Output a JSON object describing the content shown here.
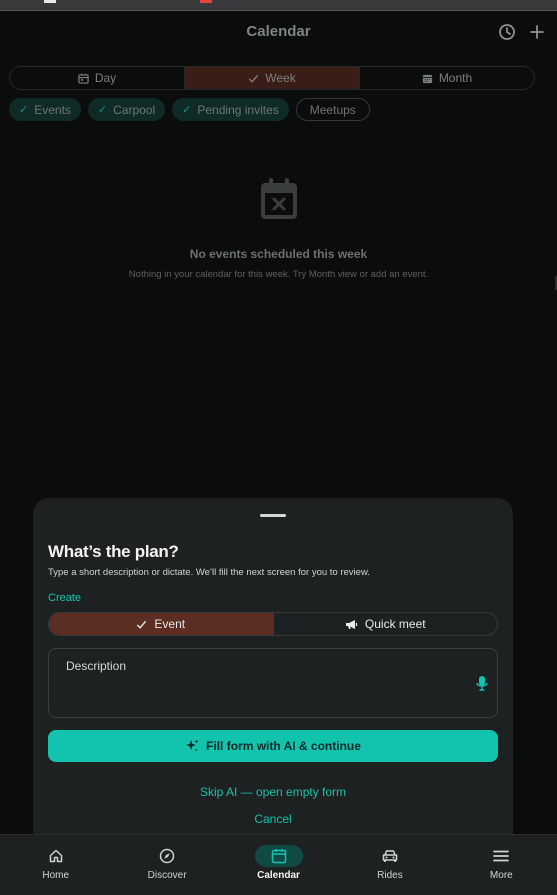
{
  "header": {
    "title": "Calendar",
    "history_icon": "history-icon",
    "add_icon": "plus-icon"
  },
  "views": [
    {
      "label": "Day",
      "icon": "calendar-day-icon",
      "active": false
    },
    {
      "label": "Week",
      "icon": "check-icon",
      "active": true
    },
    {
      "label": "Month",
      "icon": "calendar-month-icon",
      "active": false
    }
  ],
  "filters": [
    {
      "label": "Events",
      "on": true
    },
    {
      "label": "Carpool",
      "on": true
    },
    {
      "label": "Pending invites",
      "on": true
    },
    {
      "label": "Meetups",
      "on": false
    }
  ],
  "empty": {
    "icon": "calendar-x-icon",
    "title": "No events scheduled this week",
    "subtitle": "Nothing in your calendar for this week. Try Month view or add an event."
  },
  "sheet": {
    "title": "What’s the plan?",
    "subtitle": "Type a short description or dictate. We’ll fill the next screen for you to review.",
    "create_label": "Create",
    "kinds": [
      {
        "label": "Event",
        "icon": "check-icon",
        "active": true
      },
      {
        "label": "Quick meet",
        "icon": "megaphone-icon",
        "active": false
      }
    ],
    "description_label": "Description",
    "mic_icon": "microphone-icon",
    "primary_button": "Fill form with AI & continue",
    "skip_link": "Skip AI — open empty form",
    "cancel_link": "Cancel"
  },
  "nav": [
    {
      "label": "Home",
      "icon": "home-icon",
      "active": false
    },
    {
      "label": "Discover",
      "icon": "compass-icon",
      "active": false
    },
    {
      "label": "Calendar",
      "icon": "calendar-icon",
      "active": true
    },
    {
      "label": "Rides",
      "icon": "car-icon",
      "active": false
    },
    {
      "label": "More",
      "icon": "menu-icon",
      "active": false
    }
  ],
  "colors": {
    "accent": "#12c4ad",
    "active_segment": "#5c2d22",
    "sheet_bg": "#1e2121"
  }
}
